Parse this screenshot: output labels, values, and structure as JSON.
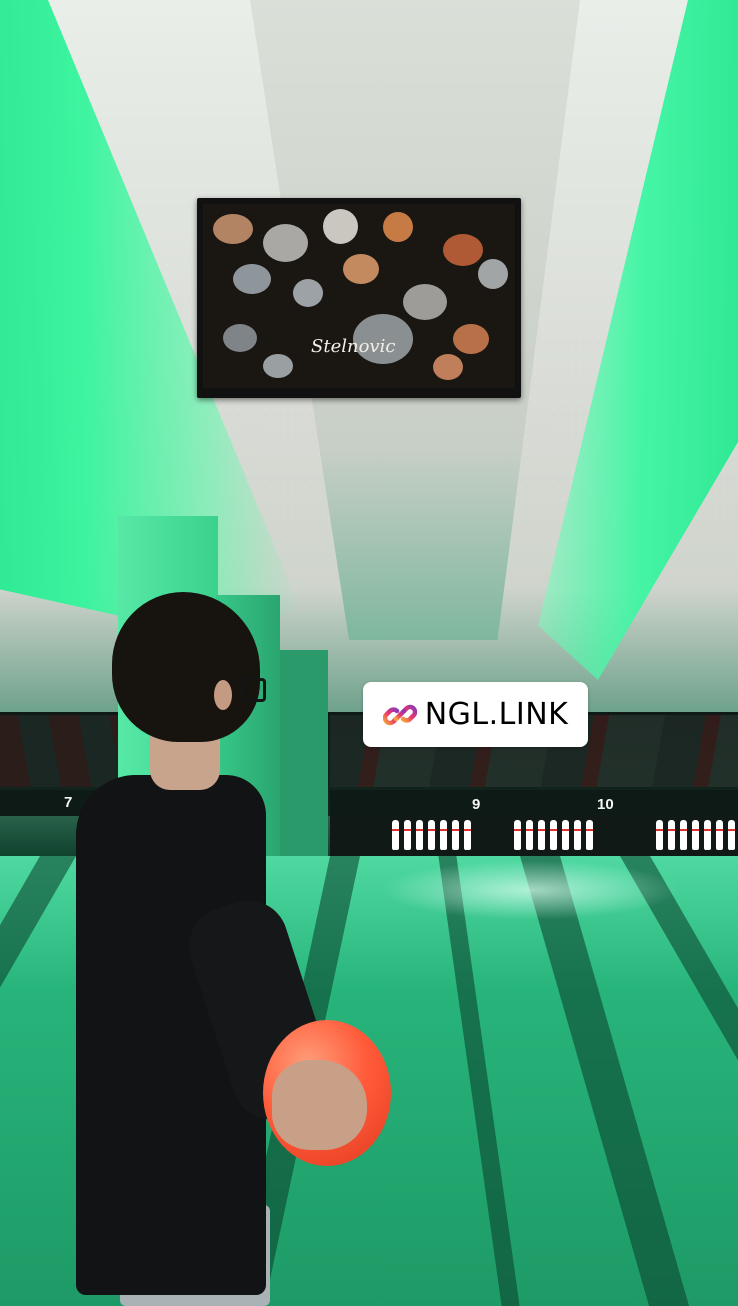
{
  "scene": {
    "description_labels": {
      "tv_logo": "Stelnovic"
    },
    "lane_numbers": [
      "7",
      "9",
      "10"
    ],
    "sticker": {
      "icon": "link-icon",
      "text": "NGL.LINK"
    },
    "colors": {
      "neon_green": "#35f59c",
      "ball": "#ff5b3a",
      "sticker_bg": "#ffffff"
    }
  }
}
